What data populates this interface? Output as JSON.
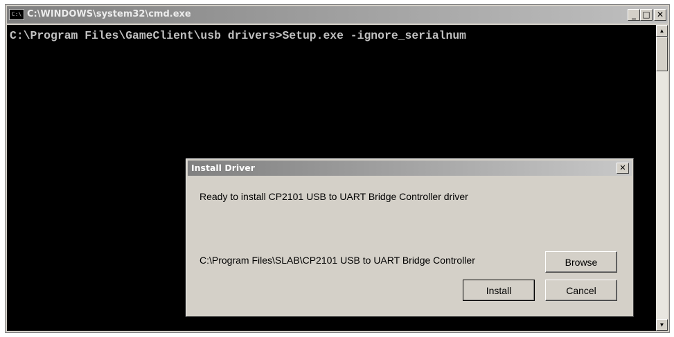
{
  "window": {
    "title": "C:\\WINDOWS\\system32\\cmd.exe",
    "icon": "cmd-icon",
    "icon_glyph": "C:\\",
    "minimize_glyph": "_",
    "maximize_glyph": "□",
    "close_glyph": "✕"
  },
  "console": {
    "line": "C:\\Program Files\\GameClient\\usb drivers>Setup.exe -ignore_serialnum"
  },
  "scrollbar": {
    "up_glyph": "▲",
    "down_glyph": "▼"
  },
  "dialog": {
    "title": "Install Driver",
    "close_glyph": "✕",
    "message": "Ready to install CP2101 USB to UART Bridge Controller driver",
    "path": "C:\\Program Files\\SLAB\\CP2101 USB to UART Bridge Controller",
    "browse_label": "Browse",
    "install_label": "Install",
    "cancel_label": "Cancel"
  },
  "colors": {
    "console_bg": "#000000",
    "console_text": "#c0c0c0",
    "window_face": "#d4d0c8"
  }
}
